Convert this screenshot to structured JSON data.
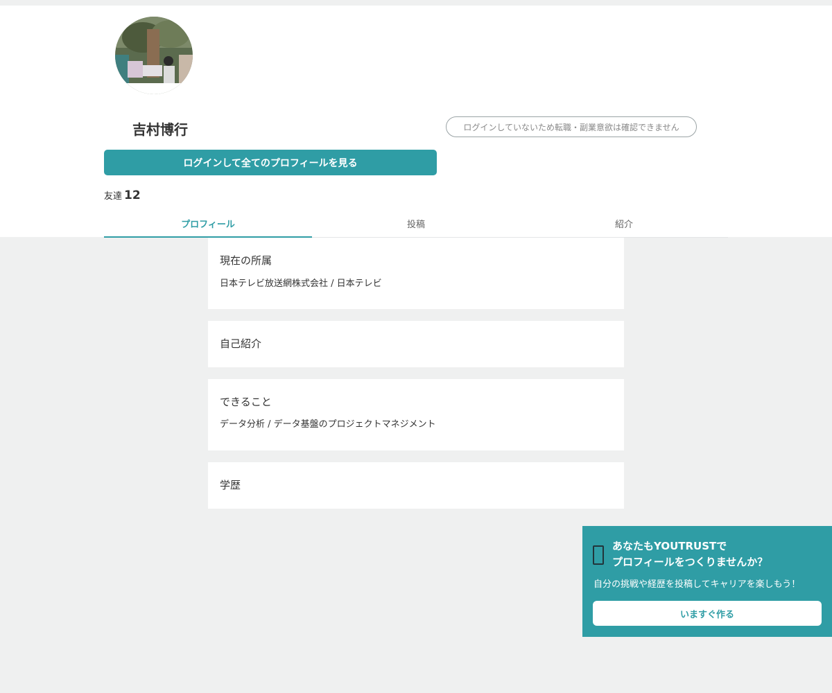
{
  "profile": {
    "name": "吉村博行",
    "career_status": "ログインしていないため転職・副業意欲は確認できません",
    "login_button": "ログインして全てのプロフィールを見る",
    "friends_label": "友達",
    "friends_count": "12"
  },
  "tabs": [
    {
      "label": "プロフィール",
      "active": true
    },
    {
      "label": "投稿",
      "active": false
    },
    {
      "label": "紹介",
      "active": false
    }
  ],
  "sections": {
    "affiliation": {
      "heading": "現在の所属",
      "body": "日本テレビ放送網株式会社 / 日本テレビ"
    },
    "intro": {
      "heading": "自己紹介"
    },
    "skills": {
      "heading": "できること",
      "body": "データ分析 / データ基盤のプロジェクトマネジメント"
    },
    "education": {
      "heading": "学歴"
    }
  },
  "cta": {
    "title_line1": "あなたもYOUTRUSTで",
    "title_line2": "プロフィールをつくりませんか？",
    "subtitle": "自分の挑戦や経歴を投稿してキャリアを楽しもう！",
    "button": "いますぐ作る",
    "icon": "smartphone-icon"
  },
  "colors": {
    "accent": "#2f9da5",
    "background": "#eff0f0"
  }
}
